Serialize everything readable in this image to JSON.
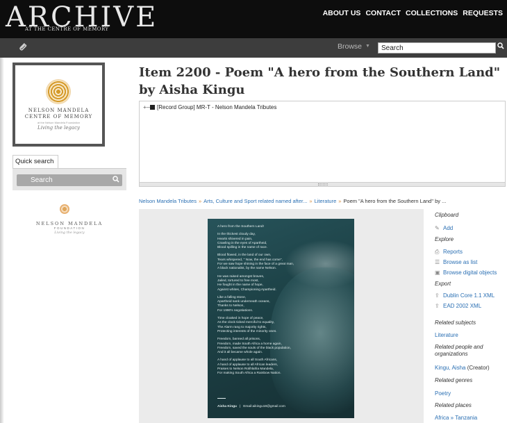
{
  "header": {
    "logo_text": "ARCHIVE",
    "logo_tagline": "AT THE CENTRE OF MEMORY",
    "nav": [
      "ABOUT US",
      "CONTACT",
      "COLLECTIONS",
      "REQUESTS"
    ]
  },
  "toolbar": {
    "browse_label": "Browse",
    "search_value": "Search"
  },
  "repository_logo": {
    "line1": "NELSON MANDELA",
    "line2": "CENTRE OF MEMORY",
    "line3": "at the Nelson Mandela Foundation",
    "line4": "Living the legacy"
  },
  "quick_search": {
    "tab_label": "Quick search",
    "placeholder": "Search"
  },
  "foundation_logo": {
    "line1": "NELSON MANDELA",
    "line2": "FOUNDATION",
    "line3": "Living the legacy"
  },
  "title": "Item 2200 - Poem \"A hero from the Southern Land\" by Aisha Kingu",
  "treeview": {
    "row_label": "[Record Group] MR-T - Nelson Mandela Tributes"
  },
  "breadcrumb": {
    "items": [
      "Nelson Mandela Tributes",
      "Arts, Culture and Sport related named after...",
      "Literature"
    ],
    "current": "Poem \"A hero from the Southern Land\" by ...",
    "separator": "»"
  },
  "poster": {
    "stanzas": [
      [
        "A hero from the Southern Land!"
      ],
      [
        "In the thickest cloudy day,",
        "Hearts shivered in pain,",
        "Crawling in the eyes of Apartheid,",
        "Blood spilling in the name of race."
      ],
      [
        "Blood flowed, in the land of our own,",
        "Tears whispered, \" Now, the end has come\",",
        "For we saw hope shining in the face of a great man,",
        "A black nationalist, by the name Nelson."
      ],
      [
        "He was raised amongst braves,",
        "Jailed, tortured to free most,",
        "He fought in the name of hope,",
        "Against whites, Championing Apartheid."
      ],
      [
        "Like a falling stone,",
        "Apartheid sank underneath oceans,",
        "Thanks to Nelson,",
        "For 1990's negotiations."
      ],
      [
        "Time cloaked in hope of peace,",
        "As the clock ticked merciful to equality,",
        "The Alarm rang to majority rights,",
        "Protecting interests of the minority ones."
      ],
      [
        "Freedom, banned all prisons,",
        "Freedom, made South Africa a home again,",
        "Freedom, saved the souls of the black population,",
        "And it all became whole again."
      ],
      [
        "A hand of applause to all South Africans,",
        "A hand of applause to all African leaders,",
        "Praises to Nelson Rolihlahla Mandela,",
        "For making South Africa a Rainbow Nation."
      ]
    ],
    "author": "Aisha Kingu",
    "divider": "|",
    "email": "Email:aikingu18@gmail.com"
  },
  "sidebar": {
    "clipboard_heading": "Clipboard",
    "add_label": "Add",
    "explore_heading": "Explore",
    "reports_label": "Reports",
    "browse_list_label": "Browse as list",
    "browse_digital_label": "Browse digital objects",
    "export_heading": "Export",
    "dublin_label": "Dublin Core 1.1 XML",
    "ead_label": "EAD 2002 XML",
    "related_subjects_heading": "Related subjects",
    "subject": "Literature",
    "related_people_heading": "Related people and organizations",
    "person_name": "Kingu, Aisha",
    "person_role": "(Creator)",
    "related_genres_heading": "Related genres",
    "genre": "Poetry",
    "related_places_heading": "Related places",
    "place": "Africa » Tanzania"
  }
}
